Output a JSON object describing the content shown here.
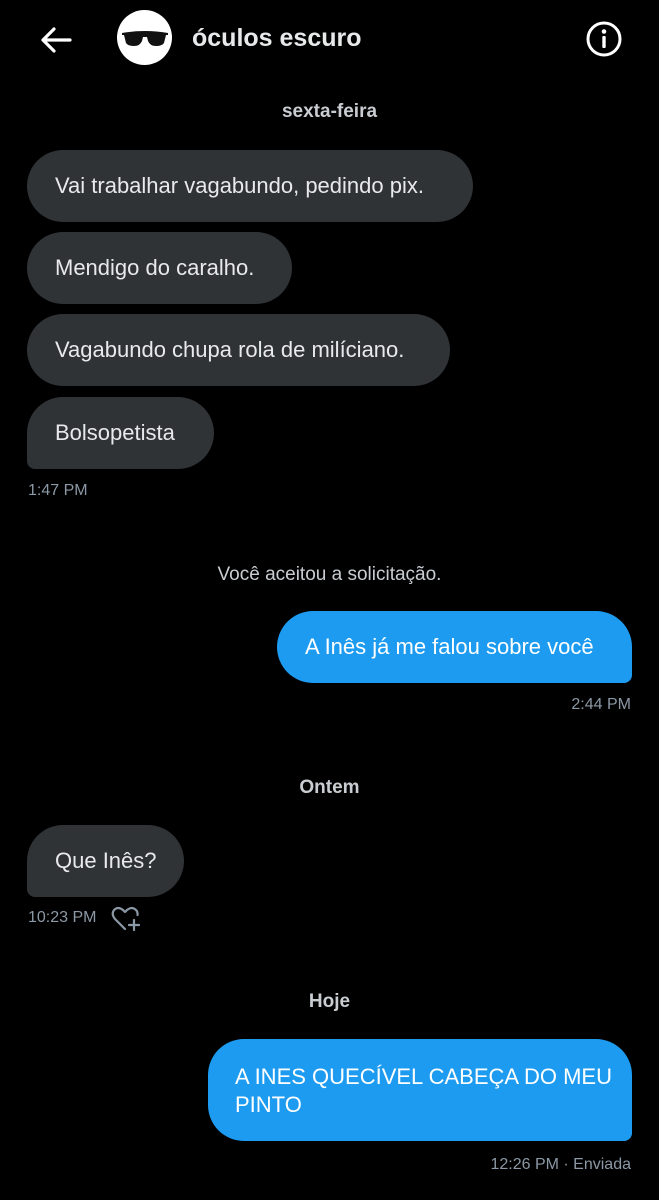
{
  "header": {
    "title": "óculos escuro",
    "back_icon": "arrow-left-icon",
    "info_icon": "info-icon",
    "avatar_icon": "sunglasses-icon"
  },
  "conversation": {
    "group1": {
      "day": "sexta-feira",
      "messages": [
        "Vai trabalhar vagabundo, pedindo pix.",
        "Mendigo do caralho.",
        "Vagabundo chupa rola de milíciano.",
        "Bolsopetista"
      ],
      "time": "1:47 PM"
    },
    "system_note": "Você aceitou a solicitação.",
    "sent1": {
      "text": "A Inês já me falou sobre você",
      "time": "2:44 PM"
    },
    "group2": {
      "day": "Ontem",
      "message": "Que Inês?",
      "time": "10:23 PM",
      "react_icon": "heart-plus-icon"
    },
    "group3": {
      "day": "Hoje",
      "text": "A INES QUECÍVEL CABEÇA DO MEU PINTO",
      "time": "12:26 PM · Enviada"
    }
  },
  "colors": {
    "background": "#000000",
    "incoming_bubble": "#2f3336",
    "outgoing_bubble": "#1d9bf0",
    "meta_text": "#8b98a5"
  }
}
